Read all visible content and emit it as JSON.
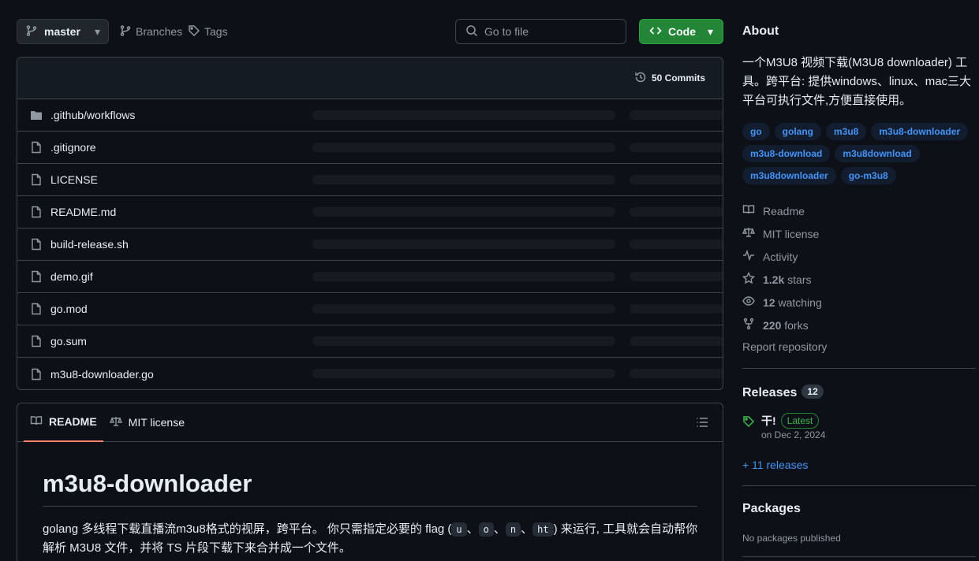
{
  "toolbar": {
    "branch_label": "master",
    "branches_label": "Branches",
    "tags_label": "Tags",
    "goto_placeholder": "Go to file",
    "code_label": "Code"
  },
  "files": {
    "commits_label": "50 Commits",
    "items": [
      {
        "name": ".github/workflows",
        "icon": "folder-icon"
      },
      {
        "name": ".gitignore",
        "icon": "file-icon"
      },
      {
        "name": "LICENSE",
        "icon": "file-icon"
      },
      {
        "name": "README.md",
        "icon": "file-icon"
      },
      {
        "name": "build-release.sh",
        "icon": "file-icon"
      },
      {
        "name": "demo.gif",
        "icon": "file-icon"
      },
      {
        "name": "go.mod",
        "icon": "file-icon"
      },
      {
        "name": "go.sum",
        "icon": "file-icon"
      },
      {
        "name": "m3u8-downloader.go",
        "icon": "file-icon"
      }
    ]
  },
  "readme": {
    "tab_readme": "README",
    "tab_license": "MIT license",
    "heading": "m3u8-downloader",
    "para_part1": "golang 多线程下载直播流m3u8格式的视屏，跨平台。 你只需指定必要的 flag (",
    "flag_u": "u",
    "sep": "、",
    "flag_o": "o",
    "flag_n": "n",
    "flag_ht": "ht",
    "para_part2": ") 来运行, 工具就会自动帮你解析 M3U8 文件，并将 TS 片段下载下来合并成一个文件。"
  },
  "about": {
    "title": "About",
    "description": "一个M3U8 视频下载(M3U8 downloader) 工具。跨平台: 提供windows、linux、mac三大平台可执行文件,方便直接使用。",
    "topics": [
      "go",
      "golang",
      "m3u8",
      "m3u8-downloader",
      "m3u8-download",
      "m3u8download",
      "m3u8downloader",
      "go-m3u8"
    ],
    "readme_label": "Readme",
    "license_label": "MIT license",
    "activity_label": "Activity",
    "stars_count": "1.2k",
    "stars_label": "stars",
    "watching_count": "12",
    "watching_label": "watching",
    "forks_count": "220",
    "forks_label": "forks",
    "report_label": "Report repository"
  },
  "releases": {
    "title": "Releases",
    "count": "12",
    "latest_name": "干!",
    "latest_badge": "Latest",
    "latest_date": "on Dec 2, 2024",
    "more_label": "+ 11 releases"
  },
  "packages": {
    "title": "Packages",
    "empty_label": "No packages published"
  },
  "colors": {
    "background": "#0d1117",
    "border": "#3d444d",
    "accent_green": "#238636",
    "link_blue": "#4493f8",
    "tab_underline": "#f78166"
  }
}
